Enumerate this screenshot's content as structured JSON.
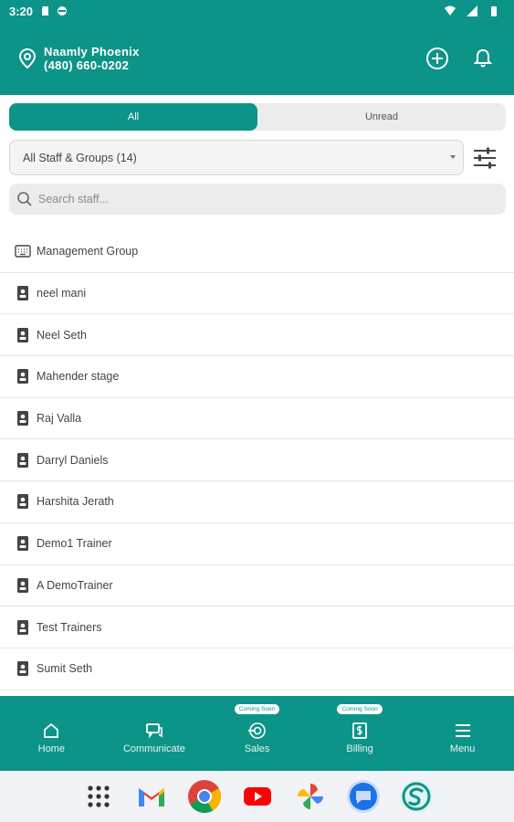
{
  "status_bar": {
    "time": "3:20"
  },
  "header": {
    "location_name": "Naamly Phoenix",
    "phone": "(480) 660-0202"
  },
  "tabs": [
    {
      "label": "All",
      "active": true
    },
    {
      "label": "Unread",
      "active": false
    }
  ],
  "filter": {
    "selected": "All Staff & Groups (14)"
  },
  "search": {
    "placeholder": "Search staff..."
  },
  "staff": [
    {
      "name": "Management Group",
      "icon": "keyboard-icon"
    },
    {
      "name": "neel mani",
      "icon": "contact-icon"
    },
    {
      "name": "Neel Seth",
      "icon": "contact-icon"
    },
    {
      "name": "Mahender stage",
      "icon": "contact-icon"
    },
    {
      "name": "Raj Valla",
      "icon": "contact-icon"
    },
    {
      "name": "Darryl Daniels",
      "icon": "contact-icon"
    },
    {
      "name": "Harshita Jerath",
      "icon": "contact-icon"
    },
    {
      "name": "Demo1 Trainer",
      "icon": "contact-icon"
    },
    {
      "name": "A DemoTrainer",
      "icon": "contact-icon"
    },
    {
      "name": "Test Trainers",
      "icon": "contact-icon"
    },
    {
      "name": "Sumit Seth",
      "icon": "contact-icon"
    }
  ],
  "bottom_nav": {
    "home": "Home",
    "communicate": "Communicate",
    "sales": "Sales",
    "billing": "Billing",
    "menu": "Menu",
    "coming_soon": "Coming Soon"
  },
  "colors": {
    "primary": "#0d9488",
    "background": "#ffffff",
    "tab_bg": "#ececec"
  }
}
